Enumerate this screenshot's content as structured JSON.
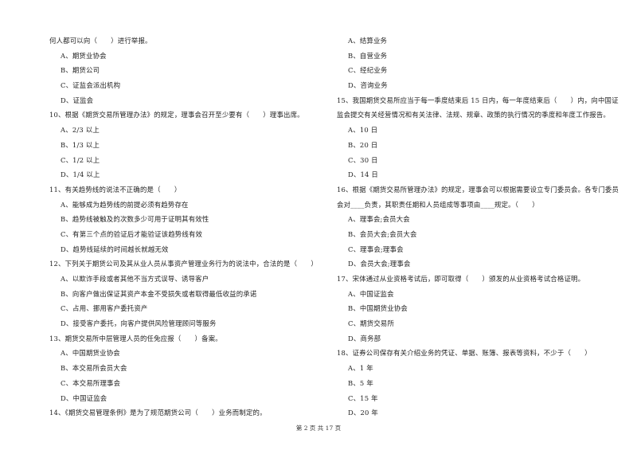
{
  "page": {
    "footer": "第 2 页 共 17 页"
  },
  "left_column": {
    "lines": [
      {
        "type": "stem",
        "text": "何人都可以向（　　）进行举报。"
      },
      {
        "type": "option",
        "text": "A、期货业协会"
      },
      {
        "type": "option",
        "text": "B、期货公司"
      },
      {
        "type": "option",
        "text": "C、证监会派出机构"
      },
      {
        "type": "option",
        "text": "D、证监会"
      },
      {
        "type": "stem",
        "text": "10、根据《期货交易所管理办法》的规定，理事会召开至少要有（　　）理事出席。"
      },
      {
        "type": "option",
        "text": "A、2/3 以上"
      },
      {
        "type": "option",
        "text": "B、1/3 以上"
      },
      {
        "type": "option",
        "text": "C、1/2 以上"
      },
      {
        "type": "option",
        "text": "D、1/4 以上"
      },
      {
        "type": "stem",
        "text": "11、有关趋势线的说法不正确的是（　　）"
      },
      {
        "type": "option",
        "text": "A、能够成为趋势线的前提必须有趋势存在"
      },
      {
        "type": "option",
        "text": "B、趋势线被触及的次数多少可用于证明其有效性"
      },
      {
        "type": "option",
        "text": "C、有第三个点的验证后才能验证该趋势线有效"
      },
      {
        "type": "option",
        "text": "D、趋势线延续的时间越长就越无效"
      },
      {
        "type": "stem",
        "text": "12、下列关于期货公司及其从业人员从事资产管理业务行为的说法中，合法的是（　　）"
      },
      {
        "type": "option",
        "text": "A、以欺诈手段或者其他不当方式误导、诱导客户"
      },
      {
        "type": "option",
        "text": "B、向客户做出保证其资产本金不受损失或者取得最低收益的承诺"
      },
      {
        "type": "option",
        "text": "C、占用、挪用客户委托资产"
      },
      {
        "type": "option",
        "text": "D、接受客户委托，向客户提供风险管理顾问等服务"
      },
      {
        "type": "stem",
        "text": "13、期货交易所中层管理人员的任免应报（　　）备案。"
      },
      {
        "type": "option",
        "text": "A、中国期货业协会"
      },
      {
        "type": "option",
        "text": "B、本交易所会员大会"
      },
      {
        "type": "option",
        "text": "C、本交易所理事会"
      },
      {
        "type": "option",
        "text": "D、中国证监会"
      },
      {
        "type": "stem",
        "text": "14、《期货交易管理条例》是为了规范期货公司（　　）业务而制定的。"
      }
    ]
  },
  "right_column": {
    "lines": [
      {
        "type": "option",
        "text": "A、结算业务"
      },
      {
        "type": "option",
        "text": "B、自营业务"
      },
      {
        "type": "option",
        "text": "C、经纪业务"
      },
      {
        "type": "option",
        "text": "D、咨询业务"
      },
      {
        "type": "stem",
        "text": "15、我国期货交易所应当于每一季度结束后 15 日内，每一年度结束后（　　）内，向中国证"
      },
      {
        "type": "stem",
        "text": "监会提交有关经营情况和有关法律、法规、规章、政策的执行情况的季度和年度工作报告。"
      },
      {
        "type": "option",
        "text": "A、10 日"
      },
      {
        "type": "option",
        "text": "B、20 日"
      },
      {
        "type": "option",
        "text": "C、30 日"
      },
      {
        "type": "option",
        "text": "D、14 日"
      },
      {
        "type": "stem",
        "text": "16、根据《期货交易所管理办法》的规定，理事会可以根据需要设立专门委员会。各专门委员"
      },
      {
        "type": "stem",
        "text": "会对____负责，其职责任期和人员组成等事项由____规定。（　　）"
      },
      {
        "type": "option",
        "text": "A、理事会;会员大会"
      },
      {
        "type": "option",
        "text": "B、会员大会;会员大会"
      },
      {
        "type": "option",
        "text": "C、理事会;理事会"
      },
      {
        "type": "option",
        "text": "D、会员大会;理事会"
      },
      {
        "type": "stem",
        "text": "17、宋体通过从业资格考试后，即可取得（　　）颁发的从业资格考试合格证明。"
      },
      {
        "type": "option",
        "text": "A、中国证监会"
      },
      {
        "type": "option",
        "text": "B、中国期货业协会"
      },
      {
        "type": "option",
        "text": "C、期货交易所"
      },
      {
        "type": "option",
        "text": "D、商务部"
      },
      {
        "type": "stem",
        "text": "18、证券公司保存有关介绍业务的凭证、单据、账簿、报表等资料，不少于（　　）"
      },
      {
        "type": "option",
        "text": "A、1 年"
      },
      {
        "type": "option",
        "text": "B、5 年"
      },
      {
        "type": "option",
        "text": "C、15 年"
      },
      {
        "type": "option",
        "text": "D、20 年"
      }
    ]
  }
}
